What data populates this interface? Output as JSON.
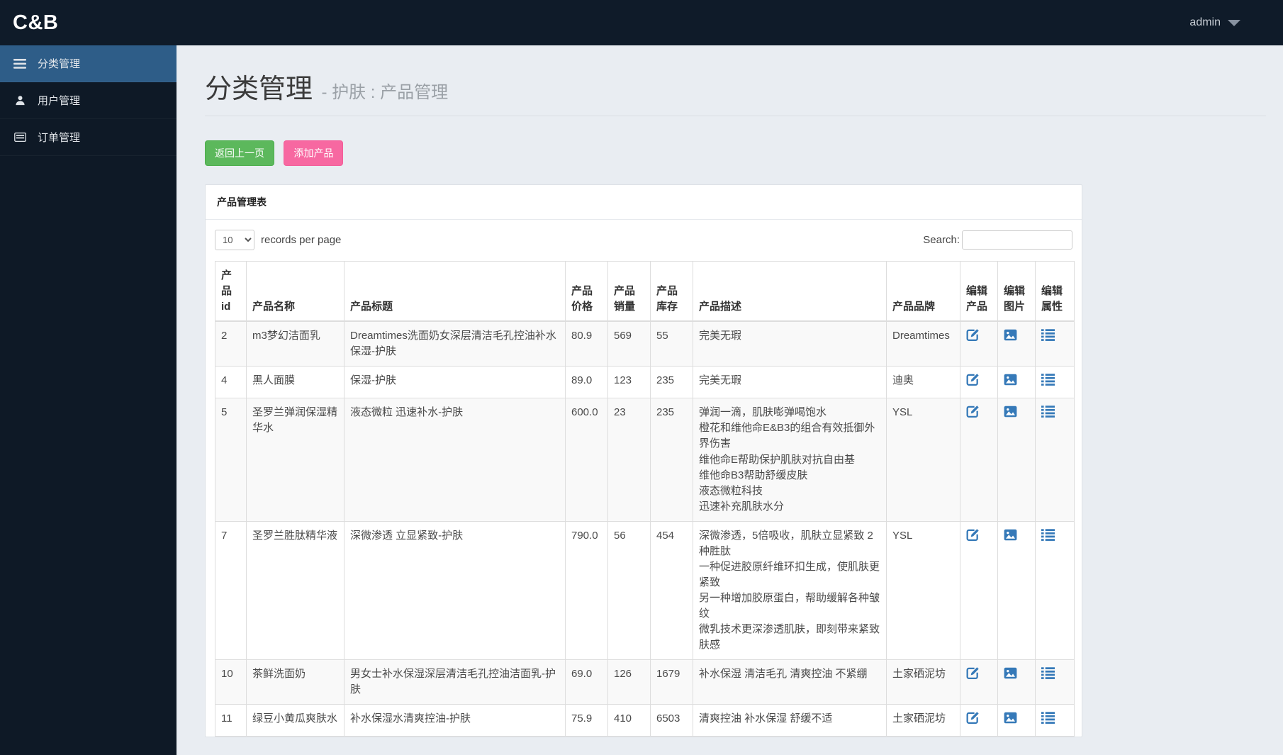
{
  "topbar": {
    "logo": "C&B",
    "user": "admin"
  },
  "sidebar": {
    "items": [
      {
        "label": "分类管理",
        "icon": "menu-icon",
        "active": true
      },
      {
        "label": "用户管理",
        "icon": "user-icon",
        "active": false
      },
      {
        "label": "订单管理",
        "icon": "order-icon",
        "active": false
      }
    ]
  },
  "page": {
    "title": "分类管理",
    "subtitle": "- 护肤 : 产品管理"
  },
  "toolbar": {
    "back_label": "返回上一页",
    "add_label": "添加产品"
  },
  "panel": {
    "title": "产品管理表"
  },
  "table_controls": {
    "page_size": "10",
    "records_text": "records per page",
    "search_label": "Search:",
    "search_value": ""
  },
  "table": {
    "headers": [
      {
        "key": "id",
        "label": "产品id"
      },
      {
        "key": "name",
        "label": "产品名称"
      },
      {
        "key": "title",
        "label": "产品标题"
      },
      {
        "key": "price",
        "label": "产品价格"
      },
      {
        "key": "sales",
        "label": "产品销量"
      },
      {
        "key": "stock",
        "label": "产品库存"
      },
      {
        "key": "desc",
        "label": "产品描述"
      },
      {
        "key": "brand",
        "label": "产品品牌"
      },
      {
        "key": "edit",
        "label": "编辑产品"
      },
      {
        "key": "img",
        "label": "编辑图片"
      },
      {
        "key": "attr",
        "label": "编辑属性"
      }
    ],
    "actions": [
      {
        "type": "edit",
        "icon": "edit-product-icon"
      },
      {
        "type": "img",
        "icon": "edit-image-icon"
      },
      {
        "type": "attr",
        "icon": "edit-attributes-icon"
      }
    ],
    "rows": [
      {
        "id": "2",
        "name": "m3梦幻洁面乳",
        "title": "Dreamtimes洗面奶女深层清洁毛孔控油补水保湿-护肤",
        "price": "80.9",
        "sales": "569",
        "stock": "55",
        "desc": [
          "完美无瑕"
        ],
        "brand": "Dreamtimes"
      },
      {
        "id": "4",
        "name": "黑人面膜",
        "title": "保湿-护肤",
        "price": "89.0",
        "sales": "123",
        "stock": "235",
        "desc": [
          "完美无瑕"
        ],
        "brand": "迪奥"
      },
      {
        "id": "5",
        "name": "圣罗兰弹润保湿精华水",
        "title": "液态微粒 迅速补水-护肤",
        "price": "600.0",
        "sales": "23",
        "stock": "235",
        "desc": [
          "弹润一滴，肌肤嘭弹喝饱水",
          "橙花和维他命E&B3的组合有效抵御外界伤害",
          "维他命E帮助保护肌肤对抗自由基",
          "维他命B3帮助舒缓皮肤",
          "液态微粒科技",
          "迅速补充肌肤水分"
        ],
        "brand": "YSL"
      },
      {
        "id": "7",
        "name": "圣罗兰胜肽精华液",
        "title": "深微渗透 立显紧致-护肤",
        "price": "790.0",
        "sales": "56",
        "stock": "454",
        "desc": [
          "深微渗透，5倍吸收，肌肤立显紧致 2种胜肽",
          "一种促进胶原纤维环扣生成，使肌肤更紧致",
          "另一种增加胶原蛋白，帮助缓解各种皱纹",
          "微乳技术更深渗透肌肤，即刻带来紧致肤感"
        ],
        "brand": "YSL"
      },
      {
        "id": "10",
        "name": "茶鲜洗面奶",
        "title": "男女士补水保湿深层清洁毛孔控油洁面乳-护肤",
        "price": "69.0",
        "sales": "126",
        "stock": "1679",
        "desc": [
          "补水保湿 清洁毛孔 清爽控油 不紧绷"
        ],
        "brand": "土家硒泥坊"
      },
      {
        "id": "11",
        "name": "绿豆小黄瓜爽肤水",
        "title": "补水保湿水清爽控油-护肤",
        "price": "75.9",
        "sales": "410",
        "stock": "6503",
        "desc": [
          "清爽控油 补水保湿 舒缓不适"
        ],
        "brand": "土家硒泥坊"
      }
    ]
  },
  "colors": {
    "topbar_bg": "#0f1b29",
    "sidebar_bg": "#0e1926",
    "sidebar_active": "#2e5d88",
    "button_green": "#5cb85c",
    "button_pink": "#f768a1",
    "icon_blue": "#3579b8",
    "content_bg": "#e9edf2"
  }
}
